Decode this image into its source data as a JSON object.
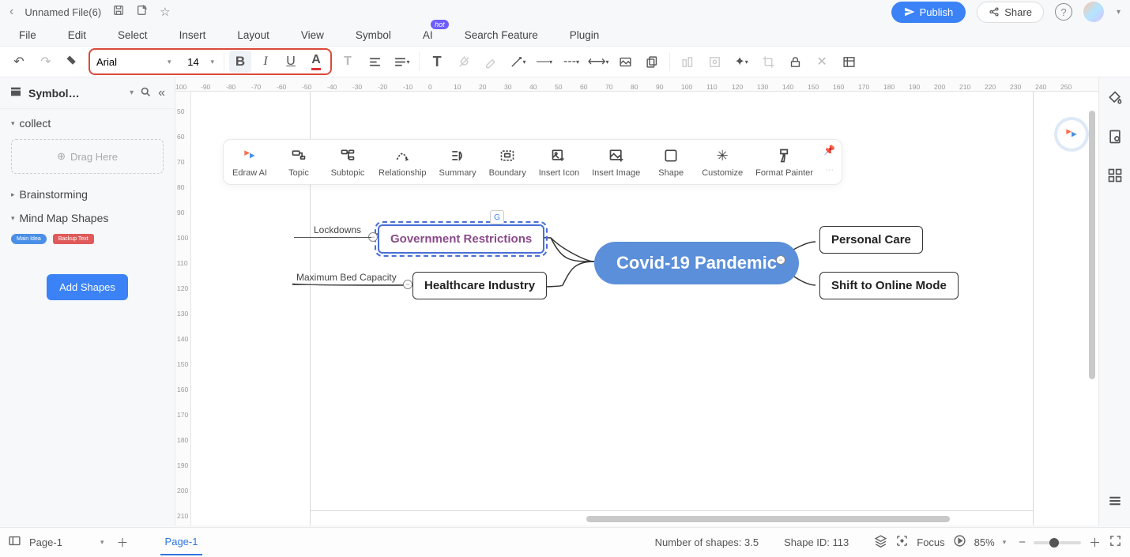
{
  "title": {
    "filename": "Unnamed File(6)"
  },
  "topbar": {
    "publish": "Publish",
    "share": "Share"
  },
  "menu": {
    "file": "File",
    "edit": "Edit",
    "select": "Select",
    "insert": "Insert",
    "layout": "Layout",
    "view": "View",
    "symbol": "Symbol",
    "ai": "AI",
    "hot": "hot",
    "search": "Search Feature",
    "plugin": "Plugin"
  },
  "toolbar": {
    "font": "Arial",
    "size": "14"
  },
  "leftpanel": {
    "library": "Symbol…",
    "sections": {
      "collect": "collect",
      "brainstorm": "Brainstorming",
      "shapes": "Mind Map Shapes"
    },
    "drag": "Drag Here",
    "chip1": "Main Idea",
    "chip2": "Backup Text",
    "add": "Add Shapes"
  },
  "minibar": {
    "edraw": "Edraw AI",
    "topic": "Topic",
    "subtopic": "Subtopic",
    "relationship": "Relationship",
    "summary": "Summary",
    "boundary": "Boundary",
    "inserticon": "Insert Icon",
    "insertimage": "Insert Image",
    "shape": "Shape",
    "customize": "Customize",
    "fpainter": "Format Painter"
  },
  "mindmap": {
    "center": "Covid-19 Pandemic",
    "gov": "Government Restrictions",
    "health": "Healthcare Industry",
    "personal": "Personal Care",
    "online": "Shift to Online Mode",
    "lockdowns": "Lockdowns",
    "bed": "Maximum Bed Capacity"
  },
  "status": {
    "page_sel": "Page-1",
    "page_tab": "Page-1",
    "shapes_count": "Number of shapes: 3.5",
    "shape_id": "Shape ID: 113",
    "focus": "Focus",
    "zoom": "85%"
  },
  "ruler_h": [
    "100",
    "-90",
    "-80",
    "-70",
    "-60",
    "-50",
    "-40",
    "-30",
    "-20",
    "-10",
    "0",
    "10",
    "20",
    "30",
    "40",
    "50",
    "60",
    "70",
    "80",
    "90",
    "100",
    "110",
    "120",
    "130",
    "140",
    "150",
    "160",
    "170",
    "180",
    "190",
    "200",
    "210",
    "220",
    "230",
    "240",
    "250"
  ],
  "ruler_v": [
    "50",
    "60",
    "70",
    "80",
    "90",
    "100",
    "110",
    "120",
    "130",
    "140",
    "150",
    "160",
    "170",
    "180",
    "190",
    "200",
    "210"
  ]
}
